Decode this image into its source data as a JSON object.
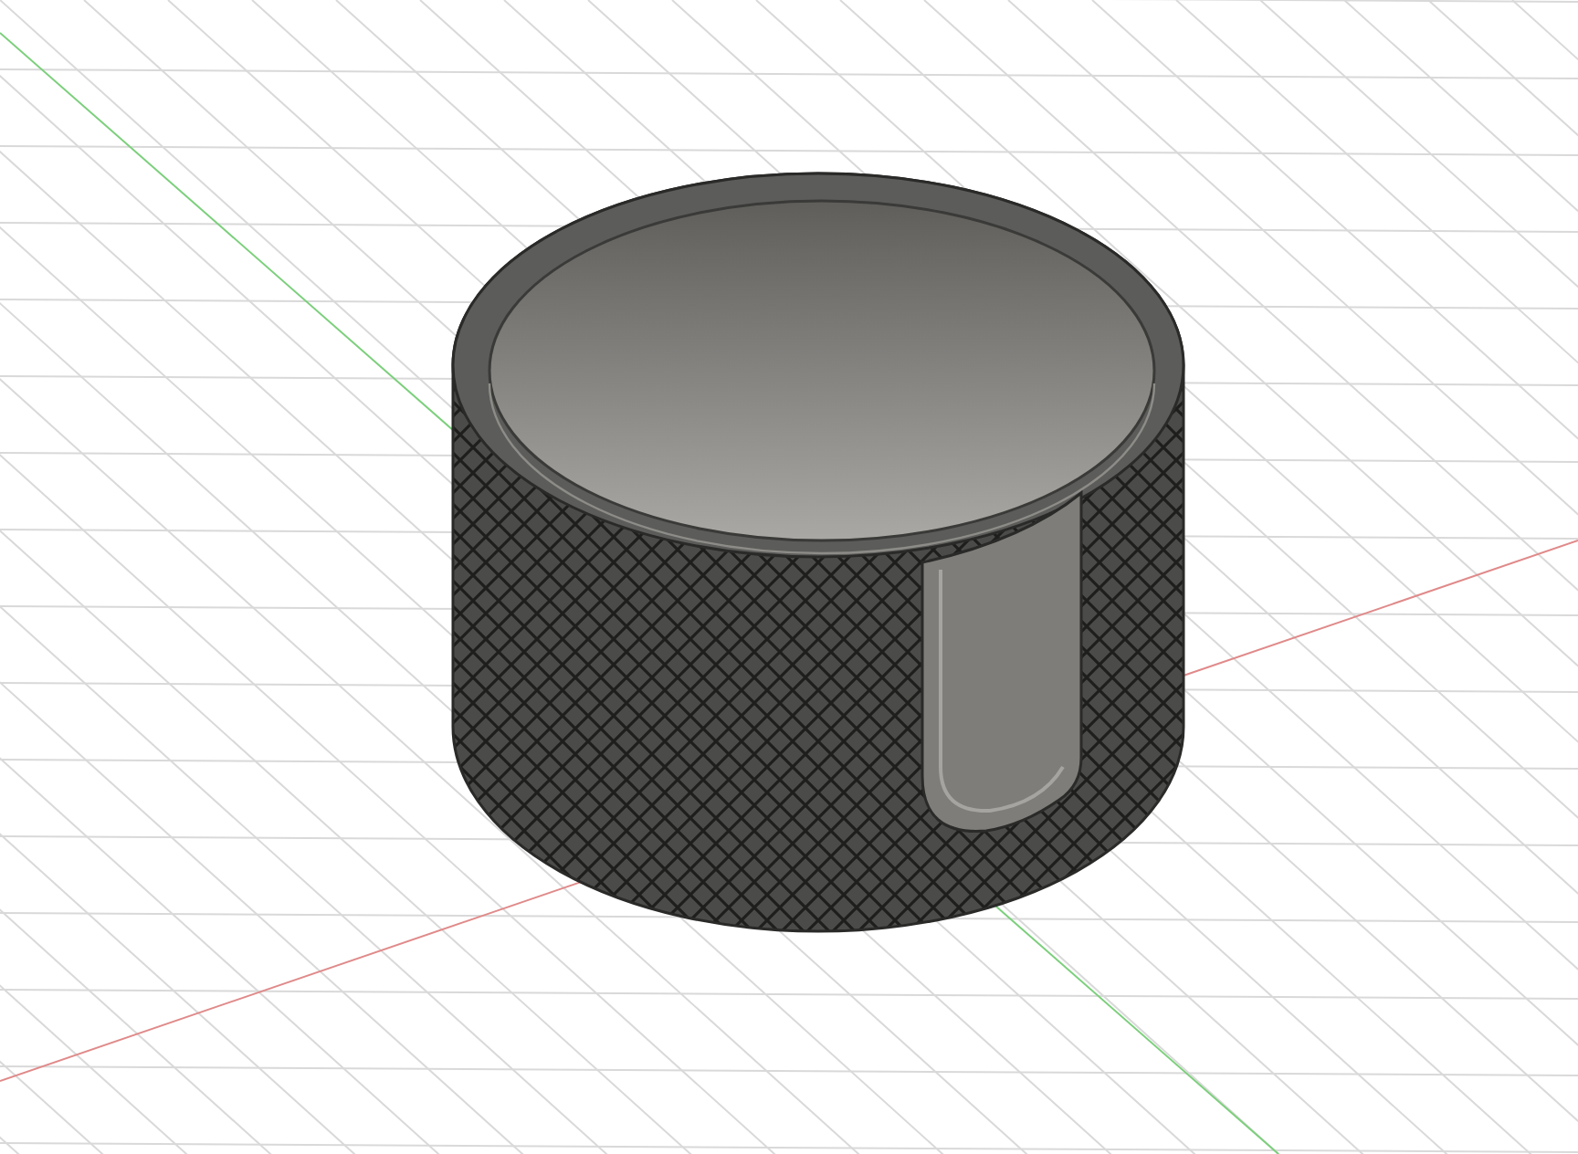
{
  "viewport": {
    "axes": [
      {
        "kind": "x",
        "color": "#e08a8a"
      },
      {
        "kind": "y",
        "color": "#7ccf7c"
      }
    ]
  }
}
